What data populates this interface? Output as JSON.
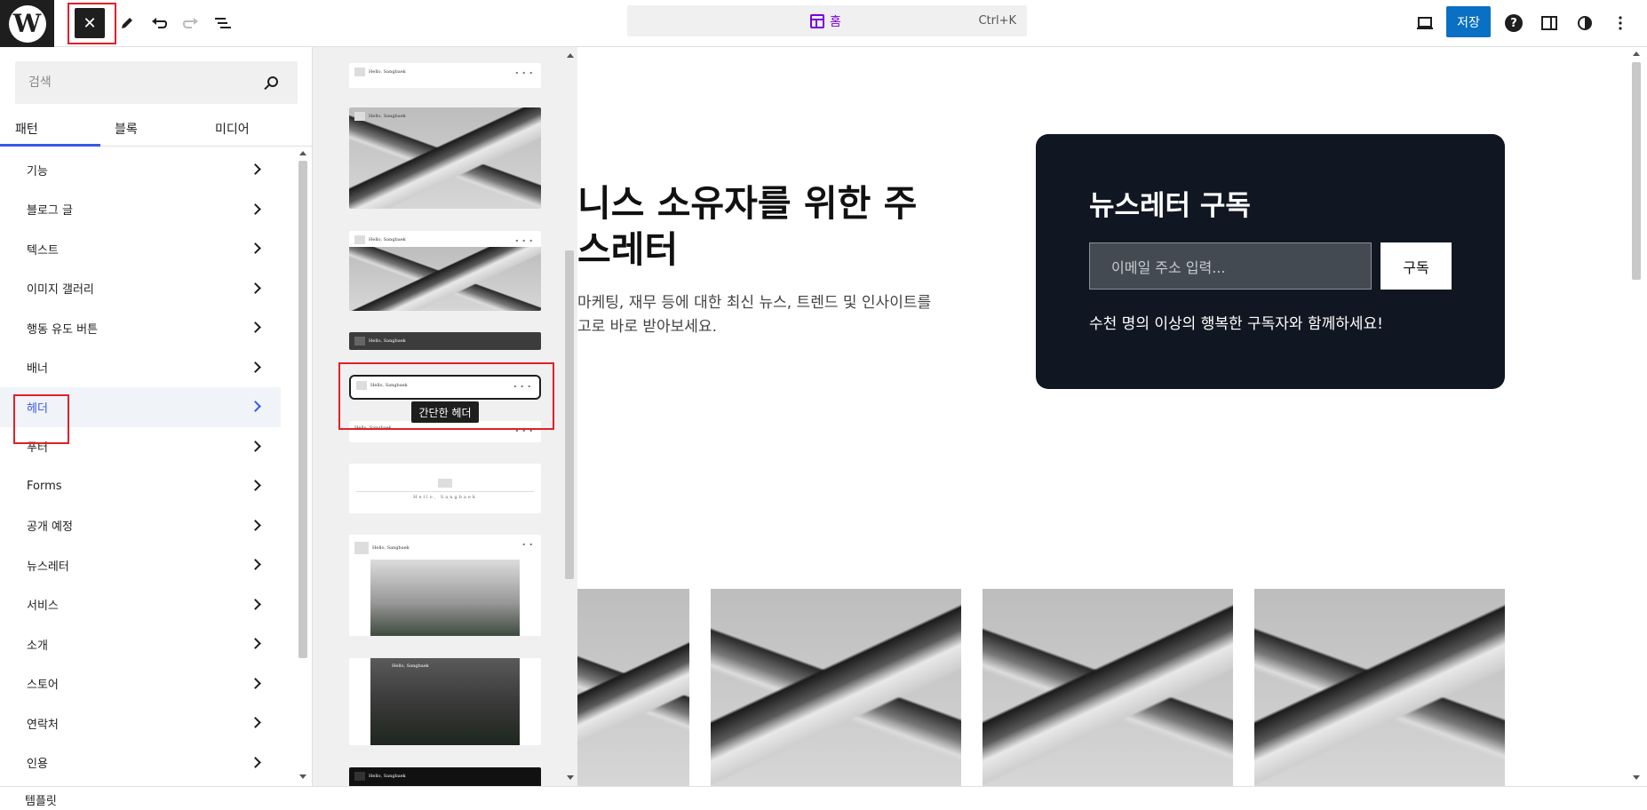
{
  "toolbar": {
    "logo": "W",
    "close_icon": "✕",
    "command_title": "홈",
    "command_shortcut": "Ctrl+K",
    "save_label": "저장",
    "help_icon": "?"
  },
  "sidebar": {
    "search_placeholder": "검색",
    "tabs": [
      {
        "label": "패턴"
      },
      {
        "label": "블록"
      },
      {
        "label": "미디어"
      }
    ],
    "categories": [
      {
        "label": "기능"
      },
      {
        "label": "블로그 글"
      },
      {
        "label": "텍스트"
      },
      {
        "label": "이미지 갤러리"
      },
      {
        "label": "행동 유도 버튼"
      },
      {
        "label": "배너"
      },
      {
        "label": "헤더"
      },
      {
        "label": "푸터"
      },
      {
        "label": "Forms"
      },
      {
        "label": "공개 예정"
      },
      {
        "label": "뉴스레터"
      },
      {
        "label": "서비스"
      },
      {
        "label": "소개"
      },
      {
        "label": "스토어"
      },
      {
        "label": "연락처"
      },
      {
        "label": "인용"
      }
    ]
  },
  "patterns": {
    "site_name": "Hello, Sangbaek",
    "tooltip": "간단한 헤더"
  },
  "canvas": {
    "hero_title": "니스 소유자를 위한 주\n스레터",
    "hero_desc": "마케팅, 재무 등에 대한 최신 뉴스, 트렌드 및 인사이트를\n고로 바로 받아보세요.",
    "newsletter": {
      "title": "뉴스레터 구독",
      "input_placeholder": "이메일 주소 입력...",
      "button": "구독",
      "note": "수천 명의 이상의 행복한 구독자와 함께하세요!"
    }
  },
  "footer": {
    "label": "템플릿"
  }
}
